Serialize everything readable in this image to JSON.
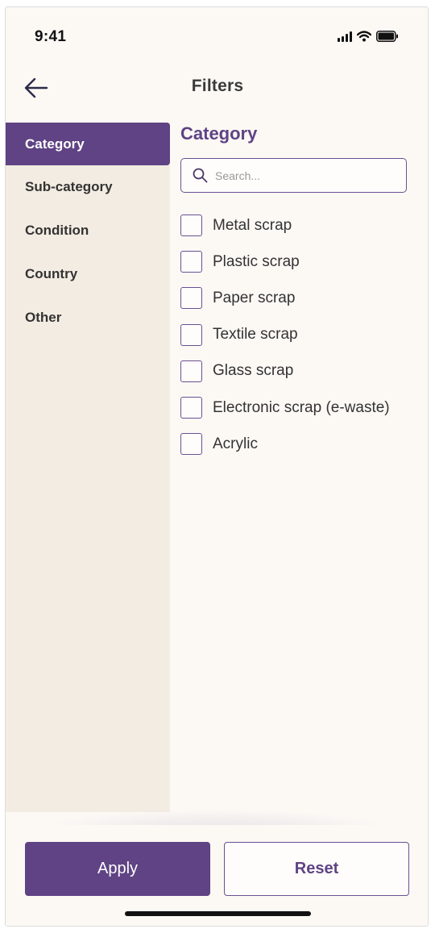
{
  "status_bar": {
    "time": "9:41"
  },
  "header": {
    "title": "Filters",
    "back_icon": "arrow-left-icon"
  },
  "sidebar": {
    "items": [
      {
        "label": "Category",
        "active": true
      },
      {
        "label": "Sub-category",
        "active": false
      },
      {
        "label": "Condition",
        "active": false
      },
      {
        "label": "Country",
        "active": false
      },
      {
        "label": "Other",
        "active": false
      }
    ]
  },
  "main": {
    "section_title": "Category",
    "search": {
      "placeholder": "Search...",
      "value": "",
      "icon": "search-icon"
    },
    "options": [
      {
        "label": "Metal scrap",
        "checked": false
      },
      {
        "label": "Plastic scrap",
        "checked": false
      },
      {
        "label": "Paper scrap",
        "checked": false
      },
      {
        "label": "Textile scrap",
        "checked": false
      },
      {
        "label": "Glass scrap",
        "checked": false
      },
      {
        "label": "Electronic scrap (e-waste)",
        "checked": false
      },
      {
        "label": "Acrylic",
        "checked": false
      }
    ]
  },
  "footer": {
    "apply_label": "Apply",
    "reset_label": "Reset"
  },
  "colors": {
    "accent": "#5f4384",
    "background": "#fcf9f5",
    "sidebar_bg": "#f3ece2"
  }
}
